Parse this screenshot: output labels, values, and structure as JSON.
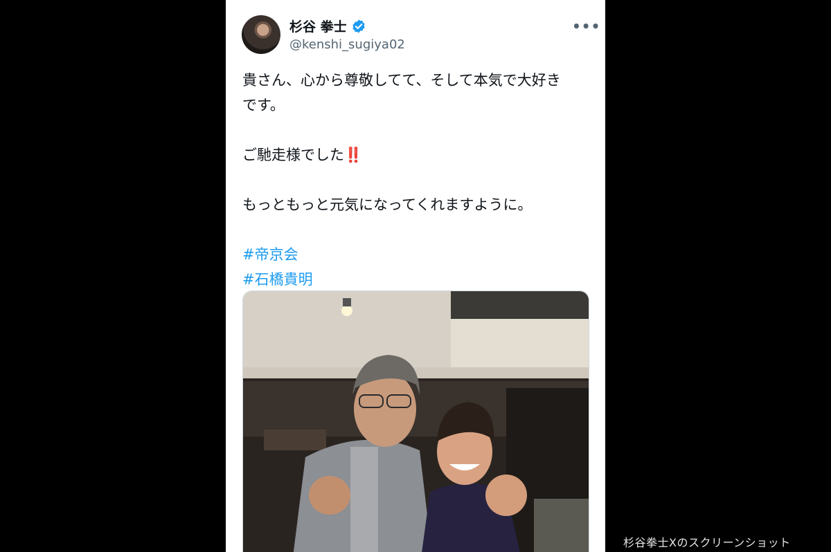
{
  "tweet": {
    "display_name": "杉谷 拳士",
    "handle": "@kenshi_sugiya02",
    "more_label": "•••",
    "lines": [
      "貴さん、心から尊敬してて、そして本気で大好き",
      "です。",
      "ご馳走様でした",
      "もっともっと元気になってくれますように。"
    ],
    "emoji": "‼️",
    "hashtags": [
      "#帝京会",
      "#石橋貴明"
    ]
  },
  "caption": "杉谷拳士Xのスクリーンショット",
  "colors": {
    "link": "#1d9bf0",
    "verified": "#1d9bf0",
    "secondary_text": "#536471",
    "emoji_red": "#e0245e"
  }
}
